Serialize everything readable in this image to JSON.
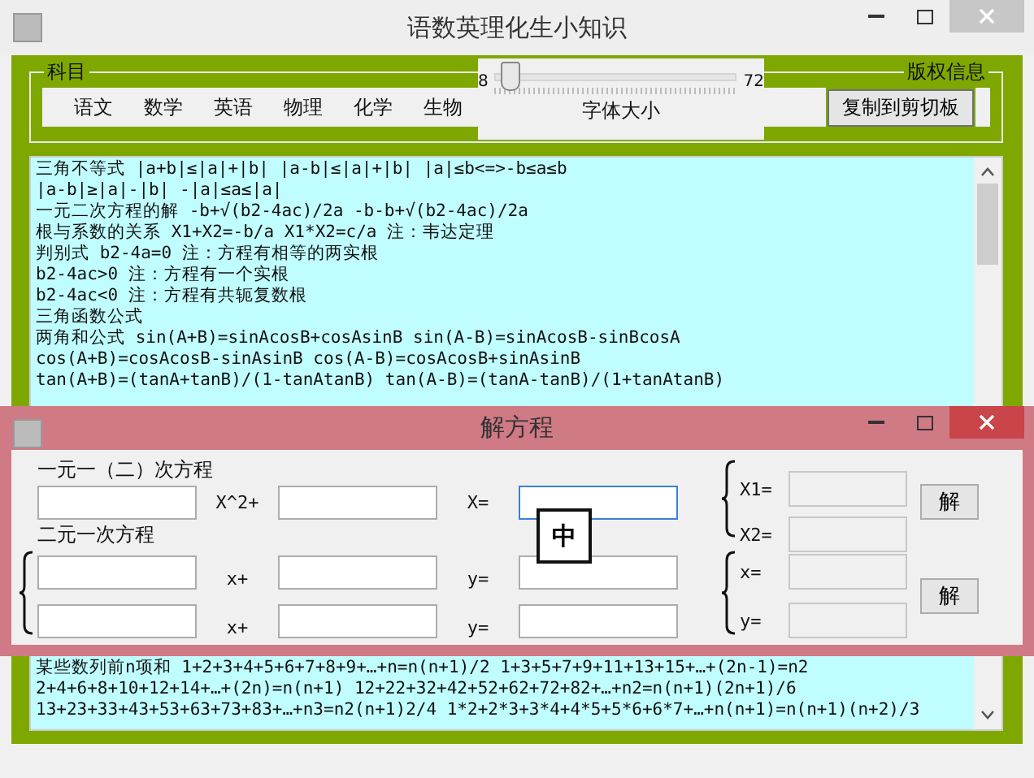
{
  "window": {
    "title": "语数英理化生小知识"
  },
  "subject_group": {
    "title": "科目",
    "copyright": "版权信息",
    "tabs": [
      "语文",
      "数学",
      "英语",
      "物理",
      "化学",
      "生物"
    ],
    "font_slider": {
      "min": "8",
      "max": "72",
      "label": "字体大小",
      "level": 0.06
    },
    "copy_button": "复制到剪切板"
  },
  "content": {
    "lines_top": [
      "三角不等式 |a+b|≤|a|+|b| |a-b|≤|a|+|b| |a|≤b<=>-b≤a≤b",
      "|a-b|≥|a|-|b| -|a|≤a≤|a|",
      "一元二次方程的解 -b+√(b2-4ac)/2a -b-b+√(b2-4ac)/2a",
      "根与系数的关系 X1+X2=-b/a X1*X2=c/a 注：韦达定理",
      "判别式 b2-4a=0 注：方程有相等的两实根",
      "b2-4ac>0 注：方程有一个实根",
      "b2-4ac<0 注：方程有共轭复数根",
      "三角函数公式",
      "两角和公式 sin(A+B)=sinAcosB+cosAsinB sin(A-B)=sinAcosB-sinBcosA",
      "cos(A+B)=cosAcosB-sinAsinB cos(A-B)=cosAcosB+sinAsinB",
      "tan(A+B)=(tanA+tanB)/(1-tanAtanB) tan(A-B)=(tanA-tanB)/(1+tanAtanB)"
    ],
    "lines_bottom": [
      "某些数列前n项和 1+2+3+4+5+6+7+8+9+…+n=n(n+1)/2 1+3+5+7+9+11+13+15+…+(2n-1)=n2",
      "2+4+6+8+10+12+14+…+(2n)=n(n+1) 12+22+32+42+52+62+72+82+…+n2=n(n+1)(2n+1)/6",
      "13+23+33+43+53+63+73+83+…+n3=n2(n+1)2/4 1*2+2*3+3*4+4*5+5*6+6*7+…+n(n+1)=n(n+1)(n+2)/3"
    ]
  },
  "dialog": {
    "title": "解方程",
    "quadratic": {
      "label": "一元一（二）次方程",
      "term_1": "X^2+",
      "term_2": "X=",
      "fields": [
        {
          "focused": false
        },
        {
          "focused": false
        },
        {
          "focused": true
        }
      ]
    },
    "linear": {
      "label": "二元一次方程",
      "rows": [
        {
          "term_1": "x+",
          "term_2": "y="
        },
        {
          "term_1": "x+",
          "term_2": "y="
        }
      ]
    },
    "results": [
      {
        "labels": [
          "X1=",
          "X2="
        ],
        "button": "解"
      },
      {
        "labels": [
          "x=",
          "y="
        ],
        "button": "解"
      }
    ],
    "ime_indicator": "中"
  }
}
